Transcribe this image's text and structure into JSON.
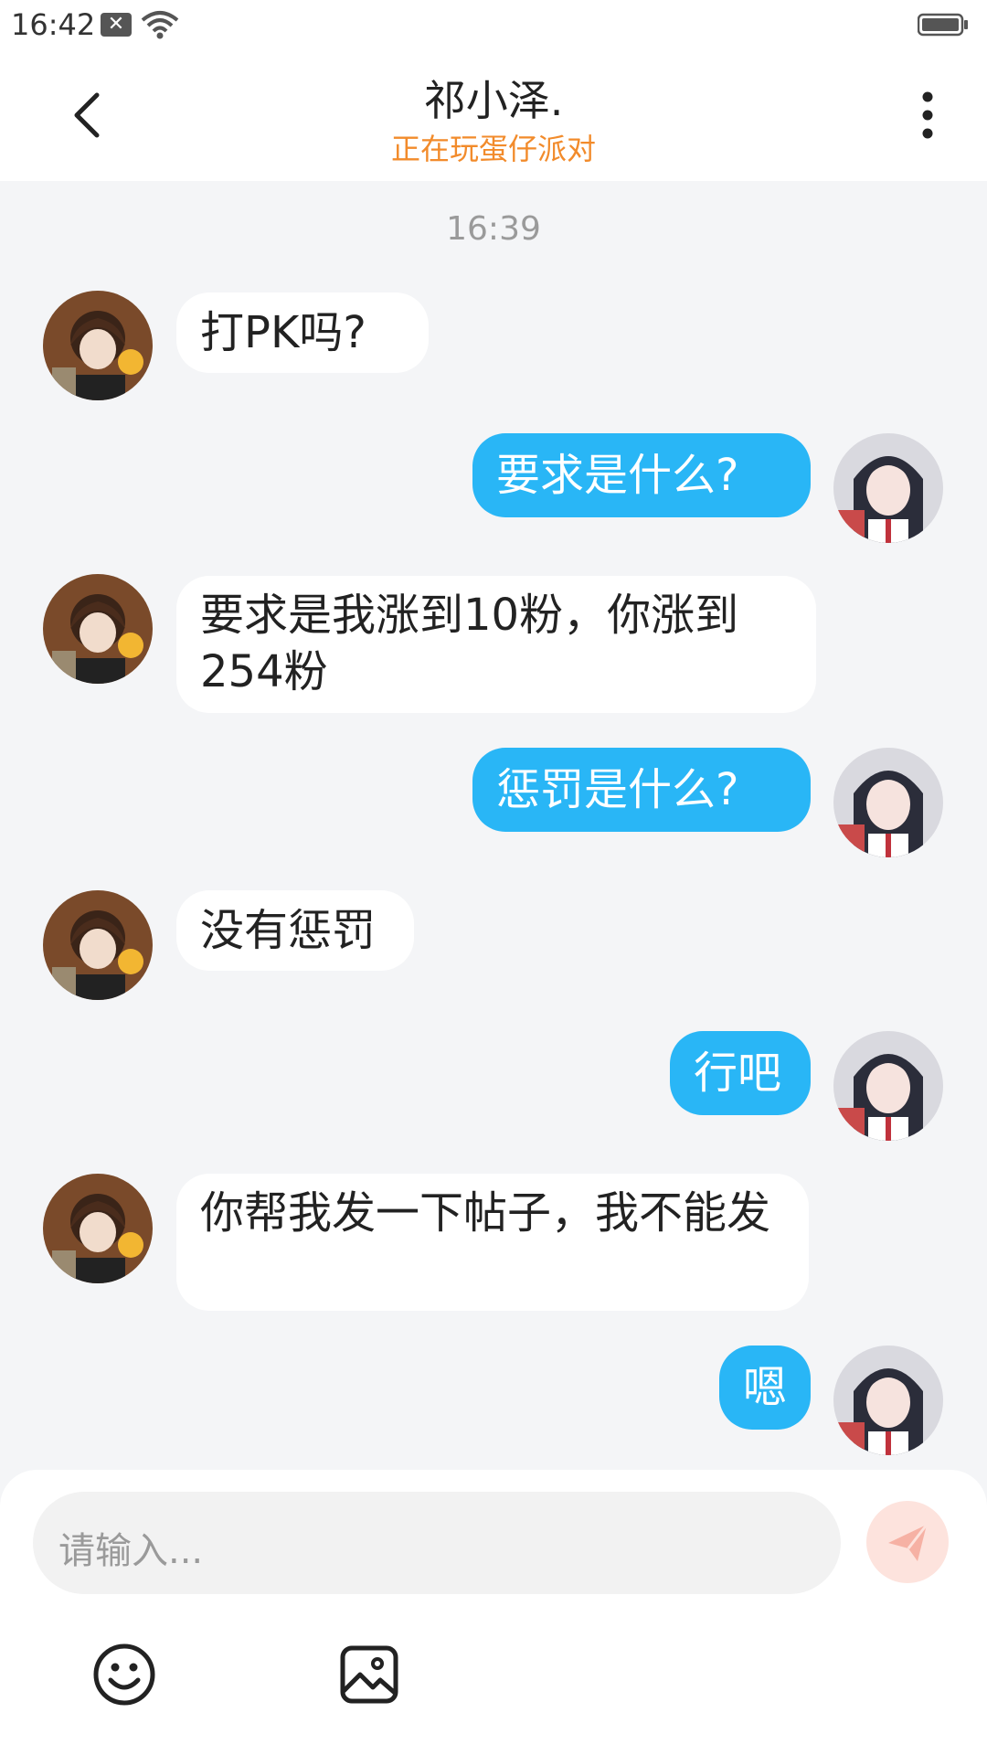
{
  "status_bar": {
    "time": "16:42",
    "notification_icon": "close-x-icon",
    "wifi_icon": "wifi-icon",
    "battery_icon": "battery-icon"
  },
  "header": {
    "title": "祁小泽.",
    "subtitle": "正在玩蛋仔派对",
    "back_icon": "back-arrow-icon",
    "more_icon": "more-vertical-icon"
  },
  "chat": {
    "timestamp": "16:39",
    "messages": [
      {
        "side": "left",
        "text": "打PK吗?"
      },
      {
        "side": "right",
        "text": "要求是什么?"
      },
      {
        "side": "left",
        "text": "要求是我涨到10粉，你涨到254粉"
      },
      {
        "side": "right",
        "text": "惩罚是什么?"
      },
      {
        "side": "left",
        "text": "没有惩罚"
      },
      {
        "side": "right",
        "text": "行吧"
      },
      {
        "side": "left",
        "text": "你帮我发一下帖子，我不能发"
      },
      {
        "side": "right",
        "text": "嗯"
      }
    ]
  },
  "input": {
    "placeholder": "请输入...",
    "send_icon": "send-icon",
    "emoji_icon": "emoji-icon",
    "image_icon": "image-icon"
  },
  "colors": {
    "accent": "#29b6f6",
    "status_orange": "#f28b2b",
    "background": "#f4f5f7"
  }
}
